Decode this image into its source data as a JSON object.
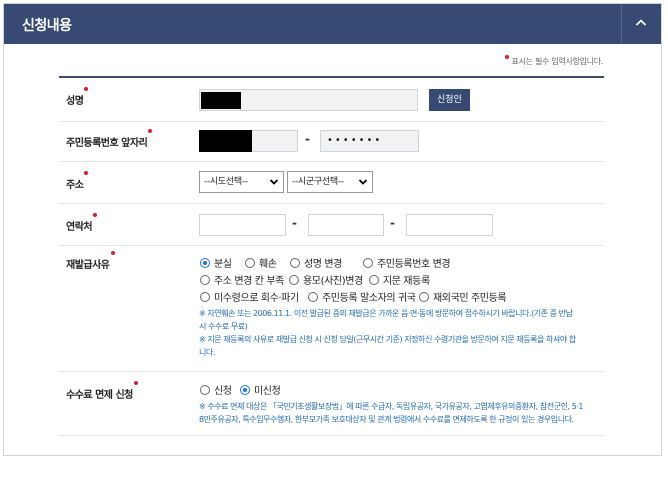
{
  "panel": {
    "title": "신청내용",
    "toggle_icon": "chevron-up-icon"
  },
  "required_note": "표시는 필수 입력사항입니다.",
  "form": {
    "name": {
      "label": "성명",
      "value": "",
      "button_label": "신청인"
    },
    "rrn": {
      "label": "주민등록번호 앞자리",
      "front_value": "",
      "dash": "-",
      "back_value": "•••••••"
    },
    "address": {
      "label": "주소",
      "sido_placeholder": "--시도선택--",
      "sigungu_placeholder": "--시군구선택--"
    },
    "contact": {
      "label": "연락처",
      "dash": "-"
    },
    "reissue": {
      "label": "재발급사유",
      "options": [
        {
          "label": "분실",
          "checked": true
        },
        {
          "label": "훼손",
          "checked": false
        },
        {
          "label": "성명 변경",
          "checked": false
        },
        {
          "label": "주민등록번호 변경",
          "checked": false
        },
        {
          "label": "주소 변경 칸 부족",
          "checked": false
        },
        {
          "label": "용모(사진)변경",
          "checked": false
        },
        {
          "label": "지문 재등록",
          "checked": false
        },
        {
          "label": "미수령으로 회수·파기",
          "checked": false
        },
        {
          "label": "주민등록 말소자의 귀국",
          "checked": false
        },
        {
          "label": "재외국민 주민등록",
          "checked": false
        }
      ],
      "notes": [
        "※ 자연훼손 또는 2006.11.1. 이전 발급된 증의 재발급은 가까운 읍·면·동에 방문하여 접수하시기 바랍니다.(기존 증 반납",
        "시 수수료 무료)",
        "※ 지문 재등록의 사유로 재발급 신청 시 신청 당일(근무시간 기준) 지정하신 수령기관을 방문하여 지문 재등록을 하셔야 합",
        "니다."
      ]
    },
    "fee": {
      "label": "수수료 면제 신청",
      "options": [
        {
          "label": "신청",
          "checked": false
        },
        {
          "label": "미신청",
          "checked": true
        }
      ],
      "notes": [
        "※ 수수료 면제 대상은 「국민기초생활보장법」에 따른 수급자, 독립유공자, 국가유공자, 고엽제후유의증환자, 참전군인, 5·1",
        "8민주유공자, 특수임무수행자, 한부모가족 보호대상자 및 관계 법령에서 수수료를 면제하도록 한 규정이 있는 경우입니다."
      ]
    }
  },
  "colors": {
    "header": "#364a73",
    "required": "#e21b2d",
    "note": "#1f6ab8",
    "radio": "#1a73e8"
  }
}
